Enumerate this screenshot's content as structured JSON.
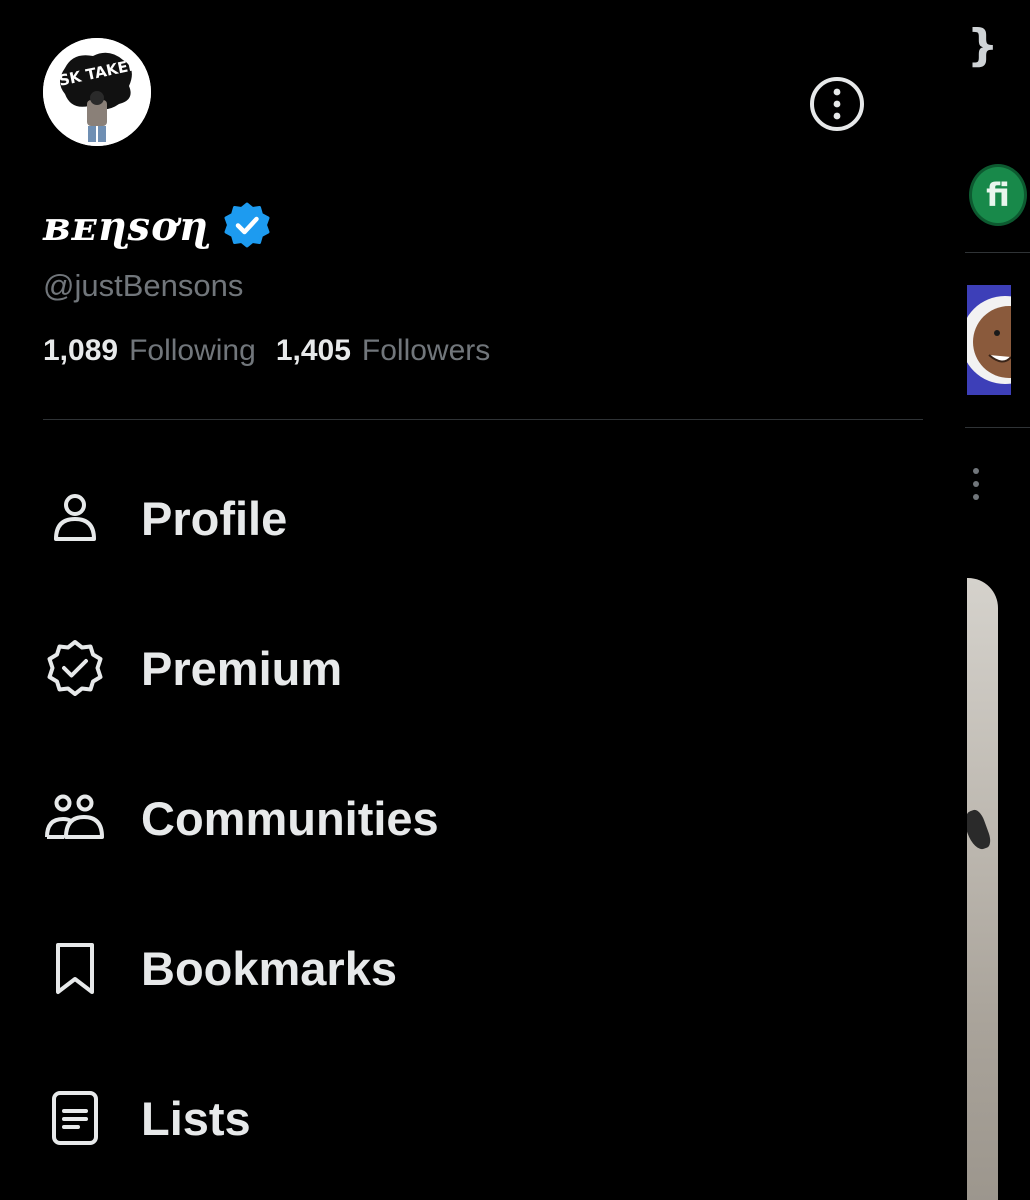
{
  "profile": {
    "avatar_text": "RISK TAKERS",
    "display_name": "ʙᴇɳsơɳ",
    "handle": "@justBensons",
    "following_count": "1,089",
    "following_label": "Following",
    "followers_count": "1,405",
    "followers_label": "Followers"
  },
  "menu": {
    "items": [
      {
        "label": "Profile",
        "icon": "person-icon"
      },
      {
        "label": "Premium",
        "icon": "verified-badge-icon"
      },
      {
        "label": "Communities",
        "icon": "communities-icon"
      },
      {
        "label": "Bookmarks",
        "icon": "bookmark-icon"
      },
      {
        "label": "Lists",
        "icon": "list-icon"
      }
    ]
  },
  "peek": {
    "top_glyph": "}",
    "fi_badge": "fi"
  },
  "colors": {
    "background": "#000000",
    "text_primary": "#e7e9ea",
    "text_secondary": "#71767b",
    "verified_blue": "#1d9bf0",
    "divider": "#2f3336"
  }
}
